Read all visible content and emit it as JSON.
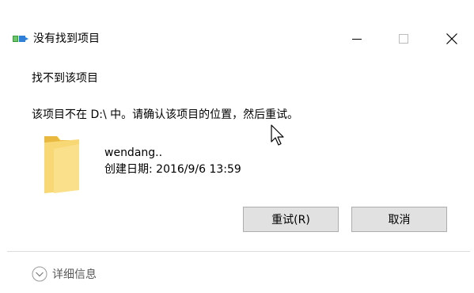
{
  "window": {
    "title": "没有找到项目",
    "icon": "folder-move-icon"
  },
  "dialog": {
    "heading": "找不到该项目",
    "message": "该项目不在 D:\\ 中。请确认该项目的位置，然后重试。",
    "item": {
      "name": "wendang..",
      "created": "创建日期: 2016/9/6 13:59",
      "icon": "folder-icon"
    }
  },
  "buttons": {
    "retry": "重试(R)",
    "cancel": "取消"
  },
  "details": {
    "label": "详细信息",
    "icon": "chevron-down-circle-icon"
  },
  "colors": {
    "folder": "#f8d775",
    "folder_dark": "#e8b93e",
    "button_bg": "#e1e1e1",
    "button_border": "#adadad",
    "details_text": "#5a5a5a"
  }
}
